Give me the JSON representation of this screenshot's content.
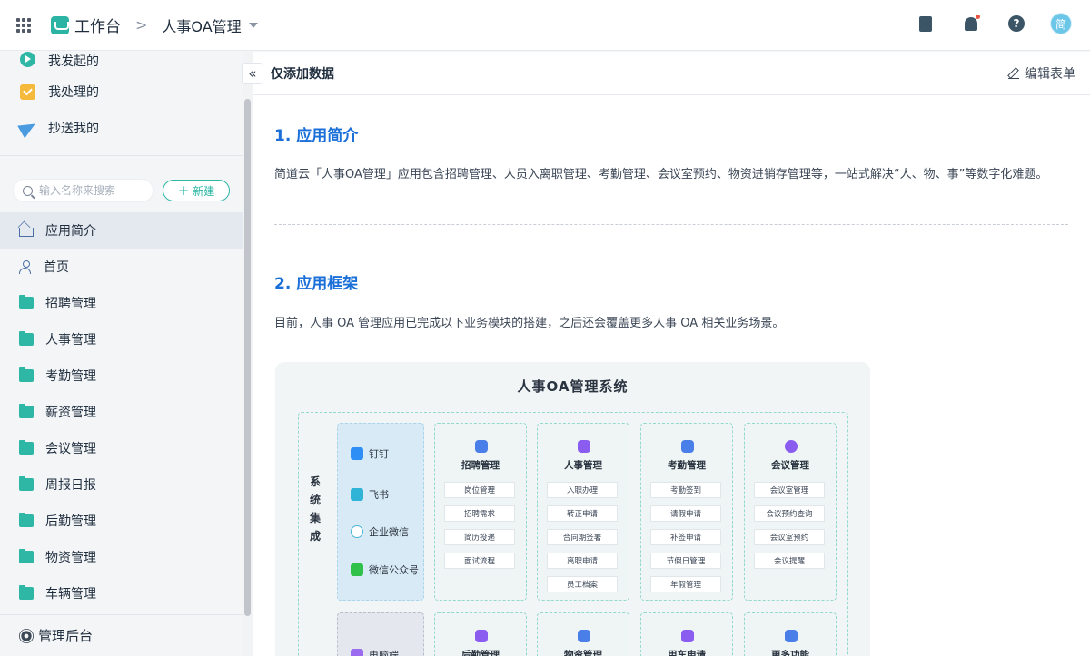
{
  "topbar": {
    "workbench": "工作台",
    "separator": ">",
    "app_title": "人事OA管理",
    "avatar_text": "简",
    "help_text": "?"
  },
  "sidebar": {
    "quick_items": [
      {
        "label": "我发起的",
        "icon": "play-circle-icon"
      },
      {
        "label": "我处理的",
        "icon": "check-box-icon"
      },
      {
        "label": "抄送我的",
        "icon": "paper-plane-icon"
      }
    ],
    "search_placeholder": "输入名称来搜索",
    "new_button": "新建",
    "nav_items": [
      {
        "label": "应用简介",
        "icon": "home-icon",
        "active": true
      },
      {
        "label": "首页",
        "icon": "user-icon"
      },
      {
        "label": "招聘管理",
        "icon": "folder-icon"
      },
      {
        "label": "人事管理",
        "icon": "folder-icon"
      },
      {
        "label": "考勤管理",
        "icon": "folder-icon"
      },
      {
        "label": "薪资管理",
        "icon": "folder-icon"
      },
      {
        "label": "会议管理",
        "icon": "folder-icon"
      },
      {
        "label": "周报日报",
        "icon": "folder-icon"
      },
      {
        "label": "后勤管理",
        "icon": "folder-icon"
      },
      {
        "label": "物资管理",
        "icon": "folder-icon"
      },
      {
        "label": "车辆管理",
        "icon": "folder-icon"
      }
    ],
    "footer": "管理后台"
  },
  "main": {
    "collapse_glyph": "«",
    "header_title": "仅添加数据",
    "edit_form": "编辑表单",
    "section1_title": "1. 应用简介",
    "section1_text": "简道云「人事OA管理」应用包含招聘管理、人员入离职管理、考勤管理、会议室预约、物资进销存管理等，一站式解决“人、物、事”等数字化难题。",
    "section2_title": "2. 应用框架",
    "section2_text": "目前，人事 OA 管理应用已完成以下业务模块的搭建，之后还会覆盖更多人事 OA 相关业务场景。"
  },
  "diagram": {
    "title": "人事OA管理系统",
    "system_label": "系统集成",
    "integrations": [
      "钉钉",
      "飞书",
      "企业微信",
      "微信公众号"
    ],
    "integration_partial": "电脑端",
    "modules": [
      {
        "title": "招聘管理",
        "items": [
          "岗位管理",
          "招聘需求",
          "简历投递",
          "面试流程"
        ]
      },
      {
        "title": "人事管理",
        "items": [
          "入职办理",
          "转正申请",
          "合同期签署",
          "离职申请",
          "员工档案"
        ]
      },
      {
        "title": "考勤管理",
        "items": [
          "考勤签到",
          "请假申请",
          "补签申请",
          "节假日管理",
          "年假管理"
        ]
      },
      {
        "title": "会议管理",
        "items": [
          "会议室管理",
          "会议预约查询",
          "会议室预约",
          "会议提醒"
        ]
      }
    ],
    "modules_row2": [
      "后勤管理",
      "物资管理",
      "用车申请",
      "更多功能"
    ]
  },
  "colors": {
    "accent": "#2db7a4",
    "heading_blue": "#1a6fd8",
    "notification_dot": "#e8543f"
  }
}
